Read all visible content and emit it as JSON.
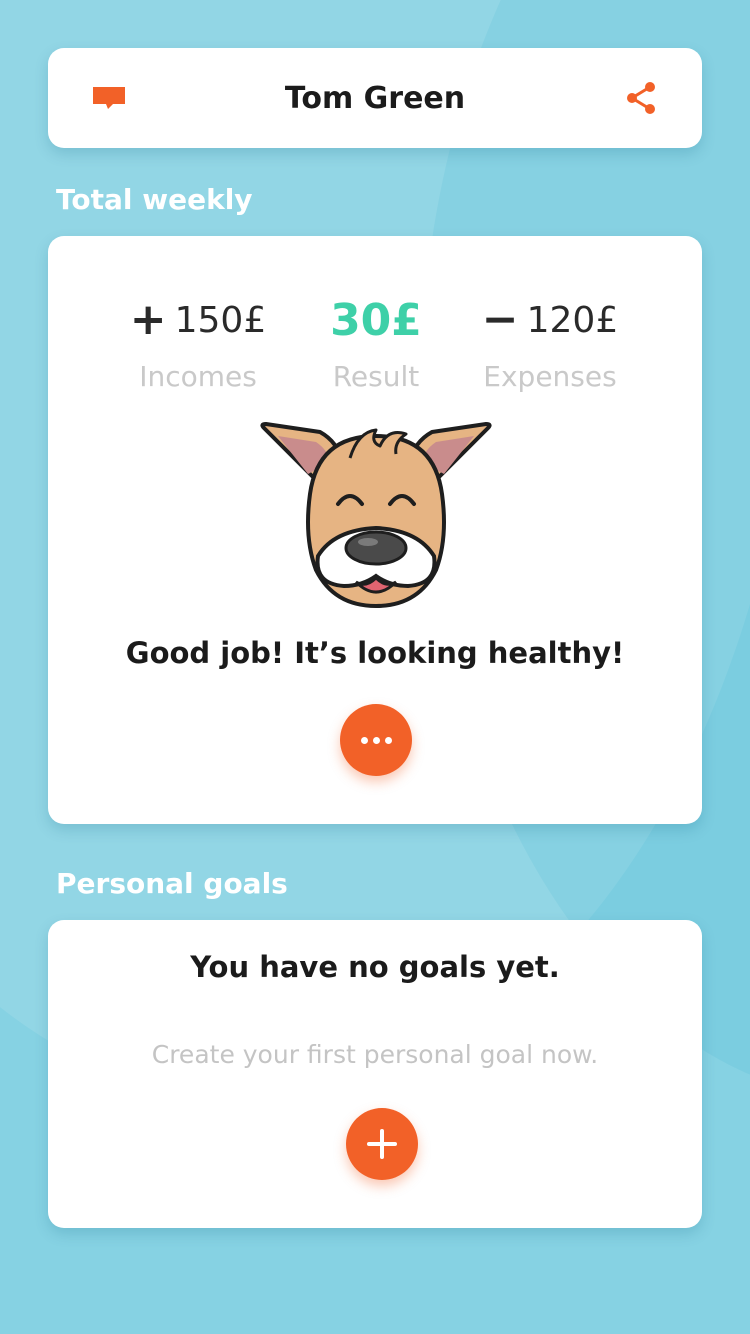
{
  "header": {
    "title": "Tom Green",
    "left_icon": "chat-bubble-icon",
    "right_icon": "share-icon"
  },
  "weekly": {
    "section_title": "Total weekly",
    "income": {
      "sign": "+",
      "amount": "150£",
      "label": "Incomes"
    },
    "result": {
      "amount": "30£",
      "label": "Result"
    },
    "expense": {
      "sign": "−",
      "amount": "120£",
      "label": "Expenses"
    },
    "mascot_icon": "happy-dog-icon",
    "message": "Good job! It’s looking healthy!",
    "more_icon": "more-dots-icon"
  },
  "goals": {
    "section_title": "Personal goals",
    "empty_title": "You have no goals yet.",
    "empty_subtitle": "Create your first personal goal now.",
    "add_icon": "plus-icon"
  },
  "colors": {
    "background": "#86d2e3",
    "accent": "#f26128",
    "result_green": "#3ed0a8"
  }
}
